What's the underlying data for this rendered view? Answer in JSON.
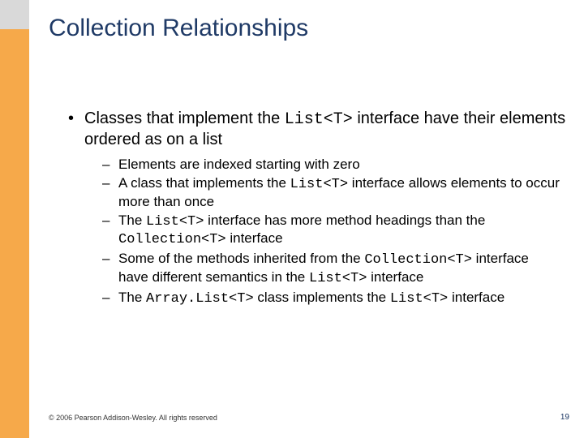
{
  "title": "Collection Relationships",
  "main_bullet": {
    "pre": "Classes that implement the ",
    "code": "List<T>",
    "post": " interface have their elements ordered as on a list"
  },
  "subs": [
    {
      "segments": [
        {
          "t": "text",
          "v": "Elements are indexed starting with zero"
        }
      ]
    },
    {
      "segments": [
        {
          "t": "text",
          "v": "A class that implements the "
        },
        {
          "t": "code",
          "v": "List<T>"
        },
        {
          "t": "text",
          "v": " interface allows elements to occur more than once"
        }
      ]
    },
    {
      "segments": [
        {
          "t": "text",
          "v": "The "
        },
        {
          "t": "code",
          "v": "List<T>"
        },
        {
          "t": "text",
          "v": " interface has more method headings than the "
        },
        {
          "t": "code",
          "v": "Collection<T>"
        },
        {
          "t": "text",
          "v": " interface"
        }
      ]
    },
    {
      "segments": [
        {
          "t": "text",
          "v": "Some of the methods inherited from the "
        },
        {
          "t": "code",
          "v": "Collection<T>"
        },
        {
          "t": "text",
          "v": " interface have different semantics in the "
        },
        {
          "t": "code",
          "v": "List<T>"
        },
        {
          "t": "text",
          "v": " interface"
        }
      ]
    },
    {
      "segments": [
        {
          "t": "text",
          "v": "The "
        },
        {
          "t": "code",
          "v": "Array.List<T>"
        },
        {
          "t": "text",
          "v": " class implements the "
        },
        {
          "t": "code",
          "v": "List<T>"
        },
        {
          "t": "text",
          "v": " interface"
        }
      ]
    }
  ],
  "footer": "© 2006 Pearson Addison-Wesley. All rights reserved",
  "page_number": "19"
}
